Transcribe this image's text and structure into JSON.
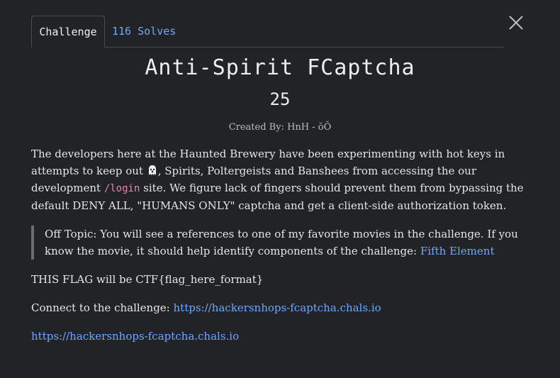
{
  "tabs": {
    "challenge": "Challenge",
    "solves": "116 Solves"
  },
  "challenge": {
    "name": "Anti-Spirit FCaptcha",
    "points": "25",
    "author": "Created By: HnH - ŏŎ"
  },
  "description": {
    "part1": "The developers here at the Haunted Brewery have been experimenting with hot keys in attempts to keep out ",
    "part2": ", Spirits, Poltergeists and Banshees from accessing the our development ",
    "login_code": "/login",
    "part3": " site. We figure lack of fingers should prevent them from bypassing the default DENY ALL, \"HUMANS ONLY\" captcha and get a client-side authorization token."
  },
  "quote": {
    "text": "Off Topic: You will see a references to one of my favorite movies in the challenge. If you know the movie, it should help identify components of the challenge: ",
    "link": "Fifth Element"
  },
  "flag_format": "THIS FLAG will be CTF{flag_here_format}",
  "connect": {
    "label": "Connect to the challenge: ",
    "url": "https://hackersnhops-fcaptcha.chals.io"
  },
  "bottom_link": "https://hackersnhops-fcaptcha.chals.io",
  "colors": {
    "background": "#222326",
    "link": "#6ea8fe",
    "code": "#e685b5"
  },
  "icons": {
    "close": "close-icon",
    "ghost": "ghost-icon"
  }
}
